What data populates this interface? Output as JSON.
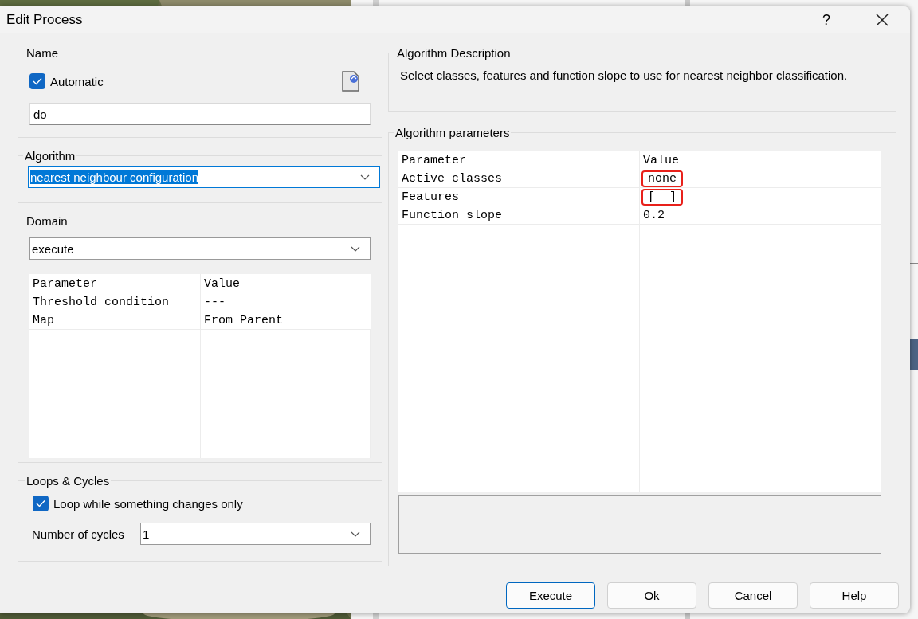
{
  "window": {
    "title": "Edit Process",
    "help": "?"
  },
  "name_group": {
    "legend": "Name",
    "automatic": {
      "label": "Automatic",
      "checked": true
    },
    "value": "do"
  },
  "algorithm_group": {
    "legend": "Algorithm",
    "value": "nearest neighbour configuration",
    "text_selected": true
  },
  "domain_group": {
    "legend": "Domain",
    "value": "execute",
    "table": {
      "columns": [
        "Parameter",
        "Value"
      ],
      "rows": [
        {
          "cells": [
            "Threshold condition",
            "---"
          ],
          "highlighted": false
        },
        {
          "cells": [
            "Map",
            "From Parent"
          ],
          "highlighted": false
        }
      ]
    }
  },
  "loops_group": {
    "legend": "Loops & Cycles",
    "loop_only": {
      "label": "Loop while something changes only",
      "checked": true
    },
    "cycles_label": "Number of cycles",
    "cycles_value": "1"
  },
  "description_group": {
    "legend": "Algorithm Description",
    "text": "Select classes, features and function slope to use for nearest neighbor classification."
  },
  "parameters_group": {
    "legend": "Algorithm parameters",
    "table": {
      "columns": [
        "Parameter",
        "Value"
      ],
      "rows": [
        {
          "cells": [
            "Active classes",
            "none"
          ],
          "highlighted": true
        },
        {
          "cells": [
            "Features",
            "[  ]"
          ],
          "highlighted": true
        },
        {
          "cells": [
            "Function slope",
            "0.2"
          ],
          "highlighted": false
        }
      ]
    }
  },
  "buttons": [
    {
      "label": "Execute",
      "default": true
    },
    {
      "label": "Ok",
      "default": false
    },
    {
      "label": "Cancel",
      "default": false
    },
    {
      "label": "Help",
      "default": false
    }
  ]
}
